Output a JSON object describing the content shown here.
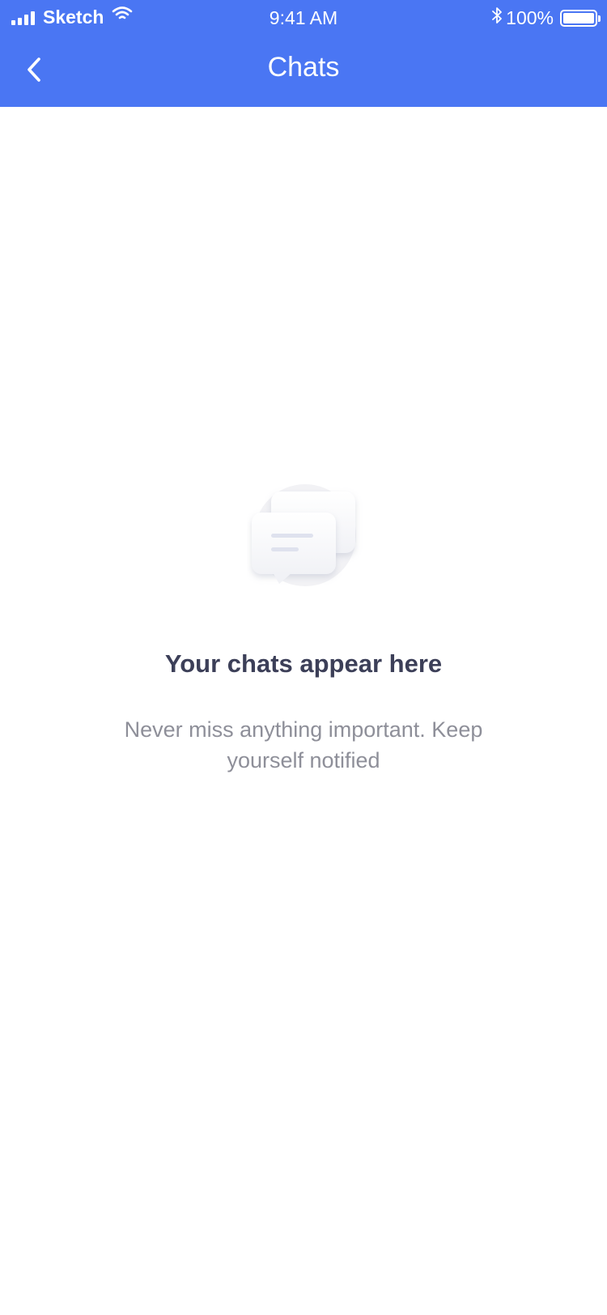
{
  "status_bar": {
    "carrier": "Sketch",
    "time": "9:41 AM",
    "battery": "100%",
    "battery_level": 1.0,
    "signal_icon": "signal-bars-icon",
    "wifi_icon": "wifi-icon",
    "bluetooth_icon": "bluetooth-icon"
  },
  "nav": {
    "title": "Chats",
    "back_icon": "chevron-left-icon"
  },
  "empty_state": {
    "illustration_icon": "chat-bubbles-icon",
    "title": "Your chats appear here",
    "subtitle": "Never miss anything important. Keep yourself notified"
  },
  "colors": {
    "header_bg": "#4a76f3",
    "title_text": "#3c3f58",
    "subtitle_text": "#8e8f99",
    "background": "#ffffff"
  }
}
